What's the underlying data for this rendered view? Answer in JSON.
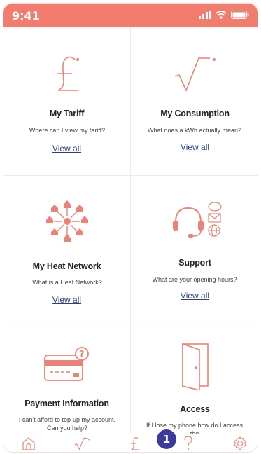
{
  "status_bar": {
    "time": "9:41",
    "color": "#f27d6e"
  },
  "cards": [
    {
      "title": "My Tariff",
      "subtitle": "Where can I view my tariff?",
      "link": "View all",
      "icon": "pound-icon"
    },
    {
      "title": "My Consumption",
      "subtitle": "What does a kWh actually mean?",
      "link": "View all",
      "icon": "square-root-icon"
    },
    {
      "title": "My Heat Network",
      "subtitle": "What is a Heat Network?",
      "link": "View all",
      "icon": "heat-network-icon"
    },
    {
      "title": "Support",
      "subtitle": "What are your opening hours?",
      "link": "View all",
      "icon": "headset-icon"
    },
    {
      "title": "Payment Information",
      "subtitle": "I can't afford to top-up my account. Can you help?",
      "icon": "credit-card-question-icon"
    },
    {
      "title": "Access",
      "subtitle": "If I lose my phone how do I access the",
      "icon": "door-icon"
    }
  ],
  "tab_bar": {
    "items": [
      "home-icon",
      "consumption-icon",
      "tariff-icon",
      "help-icon",
      "settings-icon"
    ],
    "badge": "1"
  },
  "colors": {
    "accent": "#f27d6e",
    "link": "#2c3e91",
    "badge": "#3d3a9e"
  }
}
